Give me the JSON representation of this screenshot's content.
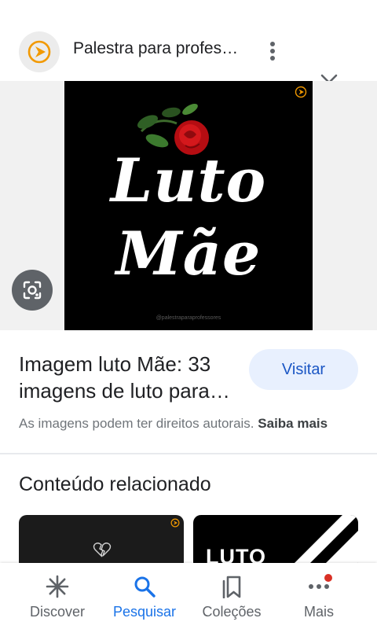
{
  "header": {
    "site_title": "Palestra para profes…"
  },
  "image": {
    "word1": "Luto",
    "word2": "Mãe",
    "caption": "@palestraparaprofessores"
  },
  "result": {
    "title": "Imagem luto Mãe: 33 imagens de luto para…",
    "visit_label": "Visitar",
    "copyright_text": "As imagens podem ter direitos autorais.",
    "learn_more": "Saiba mais"
  },
  "related": {
    "heading": "Conteúdo relacionado",
    "thumb2_text": "LUTO"
  },
  "nav": {
    "discover": "Discover",
    "search": "Pesquisar",
    "collections": "Coleções",
    "more": "Mais"
  },
  "icons": {
    "site_logo": "play-logo-icon",
    "more": "more-vert-icon",
    "close": "close-icon",
    "lens": "google-lens-icon",
    "discover": "asterisk-icon",
    "search": "search-icon",
    "collections": "bookmarks-icon",
    "more_nav": "more-horiz-icon"
  },
  "colors": {
    "accent": "#1a73e8",
    "visit_bg": "#e8f0fe",
    "badge": "#d93025",
    "logo_orange": "#f29900"
  }
}
